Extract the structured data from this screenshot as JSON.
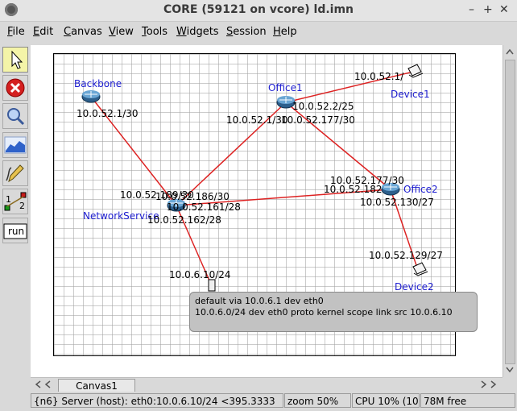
{
  "window": {
    "title": "CORE (59121 on vcore) ld.imn",
    "minimize": "–",
    "maximize": "+",
    "close": "✕"
  },
  "menubar": {
    "items": [
      "File",
      "Edit",
      "Canvas",
      "View",
      "Tools",
      "Widgets",
      "Session",
      "Help"
    ]
  },
  "toolbar": {
    "tools": [
      {
        "name": "select-tool",
        "icon": "arrow-cursor-icon",
        "selected": true
      },
      {
        "name": "stop-tool",
        "icon": "stop-icon"
      },
      {
        "name": "zoom-tool",
        "icon": "magnifier-icon"
      },
      {
        "name": "plot-tool",
        "icon": "graph-icon"
      },
      {
        "name": "annotate-tool",
        "icon": "pencil-icon"
      },
      {
        "name": "twonode-tool",
        "icon": "two-node-icon",
        "label": "1 2"
      },
      {
        "name": "run-tool",
        "icon": "run-tool-icon",
        "label": "run"
      }
    ]
  },
  "nodes": {
    "backbone": {
      "name": "Backbone",
      "ip": "10.0.52.1/30"
    },
    "office1": {
      "name": "Office1",
      "ips": [
        "10.0.52.2/25",
        "10.0.52.1/30",
        "10.0.52.177/30"
      ]
    },
    "networkservice": {
      "name": "NetworkService",
      "ips": [
        "10.0.52.189/30",
        "10.0.52.186/30",
        "10.0.52.161/28",
        "10.0.52.162/28"
      ]
    },
    "office2": {
      "name": "Office2",
      "ips": [
        "10.0.52.177/30",
        "10.0.52.182",
        "10.0.52.130/27"
      ]
    },
    "device1": {
      "name": "Device1",
      "ip": "10.0.52.1/"
    },
    "device2": {
      "name": "Device2",
      "ip": "10.0.52.129/27"
    },
    "server": {
      "ip": "10.0.6.10/24"
    }
  },
  "tooltip": {
    "line1": "default via 10.0.6.1 dev eth0",
    "line2": "10.0.6.0/24 dev eth0  proto kernel  scope link  src 10.0.6.10"
  },
  "canvas_tabs": [
    "Canvas1"
  ],
  "status": {
    "node_info": "{n6} Server (host): eth0:10.0.6.10/24 <395.3333",
    "zoom": "zoom 50%",
    "cpu": "CPU 10% (10",
    "mem": "78M free"
  },
  "colors": {
    "link": "#dd2222",
    "node_label": "#1c1cd0",
    "selected_tool": "#f4f4a8"
  }
}
